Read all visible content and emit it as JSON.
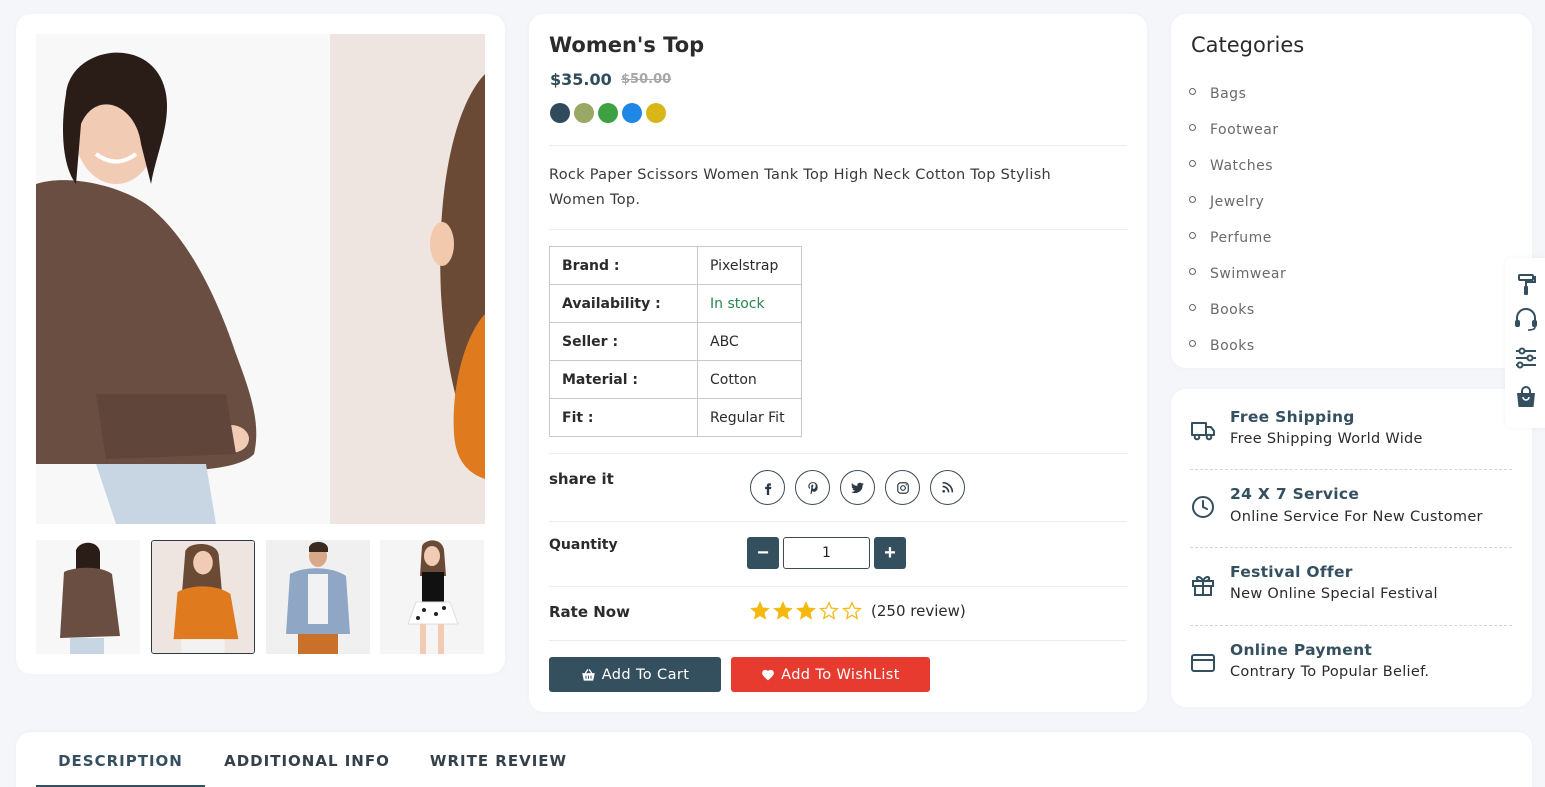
{
  "product": {
    "title": "Women's Top",
    "price": "$35.00",
    "old_price": "$50.00",
    "colors": [
      "#2f4b5c",
      "#99a864",
      "#3da043",
      "#1f87e5",
      "#d9b718"
    ],
    "description": "Rock Paper Scissors Women Tank Top High Neck Cotton Top Stylish Women Top.",
    "specs": [
      {
        "key": "Brand   :",
        "value": "Pixelstrap"
      },
      {
        "key": "Availability   :",
        "value": "In stock"
      },
      {
        "key": "Seller   :",
        "value": "ABC"
      },
      {
        "key": "Material   :",
        "value": "Cotton"
      },
      {
        "key": "Fit   :",
        "value": "Regular Fit"
      }
    ],
    "share_label": "share it",
    "share_icons": [
      "facebook-icon",
      "pinterest-icon",
      "twitter-icon",
      "instagram-icon",
      "rss-icon"
    ],
    "quantity_label": "Quantity",
    "quantity_value": "1",
    "rate_label": "Rate Now",
    "rating": 3,
    "rating_max": 5,
    "review_count": "(250 review)",
    "add_to_cart": "Add To Cart",
    "add_to_wishlist": "Add To WishList"
  },
  "categories": {
    "title": "Categories",
    "items": [
      "Bags",
      "Footwear",
      "Watches",
      "Jewelry",
      "Perfume",
      "Swimwear",
      "Books",
      "Books"
    ]
  },
  "services": [
    {
      "icon": "truck-icon",
      "title": "Free Shipping",
      "subtitle": "Free Shipping World Wide"
    },
    {
      "icon": "clock-icon",
      "title": "24 X 7 Service",
      "subtitle": "Online Service For New Customer"
    },
    {
      "icon": "gift-icon",
      "title": "Festival Offer",
      "subtitle": "New Online Special Festival"
    },
    {
      "icon": "card-icon",
      "title": "Online Payment",
      "subtitle": "Contrary To Popular Belief."
    }
  ],
  "tabs": [
    "DESCRIPTION",
    "ADDITIONAL INFO",
    "WRITE REVIEW"
  ],
  "floatbar_icons": [
    "paint-roller-icon",
    "headset-icon",
    "sliders-icon",
    "shopping-bag-icon"
  ],
  "colors": {
    "primary": "#34505f",
    "danger": "#e83b30",
    "star": "#f5b80d",
    "in_stock": "#28864e"
  }
}
